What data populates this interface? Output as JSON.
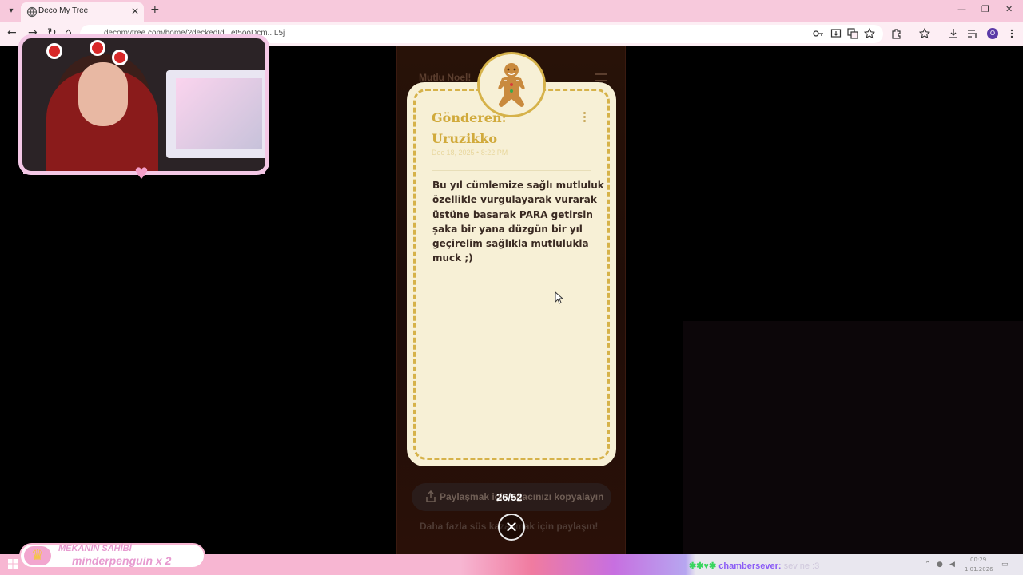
{
  "browser": {
    "tab_title": "Deco My Tree",
    "tab_close": "✕",
    "new_tab": "+",
    "url": "decomytree.com/home/?deckedId...et5ooDcm...L5j",
    "profile_initial": "O",
    "window_controls": [
      "—",
      "❐",
      "✕"
    ]
  },
  "page": {
    "background_heading": "Mutlu Noel!",
    "colors": {
      "card_bg": "#f7f0d6",
      "card_border": "#d6b24a",
      "accent": "#d1aa3c"
    }
  },
  "message": {
    "ornament_icon": "gingerbread-man-icon",
    "sender_label": "Gönderen:",
    "sender_name": "Uruzikko",
    "date": "Dec 18, 2025 • 8:22 PM",
    "lines": [
      "Bu yıl cümlemize sağlı mutluluk",
      "özellikle vurgulayarak vurarak",
      "üstüne basarak PARA getirsin",
      "şaka bir yana düzgün bir yıl",
      "geçirelim sağlıkla mutlulukla",
      "muck ;)"
    ]
  },
  "footer": {
    "share_button": "Paylaşmak için ağacınızı kopyalayın",
    "share_more": "Daha fazla süs kazanmak için paylaşın!",
    "counter": "26/52"
  },
  "overlay": {
    "sahibi_title": "MEKANIN SAHİBİ",
    "sahibi_name": "minderpenguin x 2",
    "chat_user": "chambersever:",
    "chat_message": "sev ne :3",
    "clock_time": "00:29",
    "clock_date": "1.01.2026"
  }
}
